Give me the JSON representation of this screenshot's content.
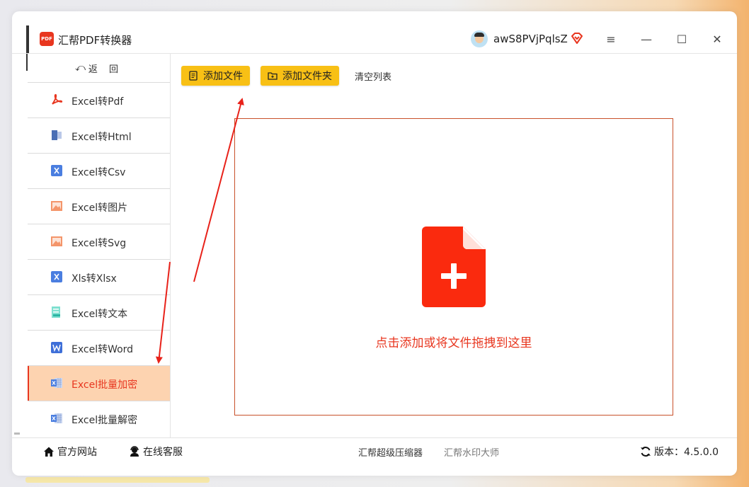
{
  "app": {
    "title": "汇帮PDF转换器",
    "logo_text": "PDF"
  },
  "user": {
    "name": "awS8PVjPqlsZ"
  },
  "window_controls": {
    "menu": "≡",
    "minimize": "—",
    "maximize": "☐",
    "close": "✕"
  },
  "sidebar": {
    "back": {
      "arrow": "⤺",
      "label": "返 回"
    },
    "items": [
      {
        "label": "Excel转Pdf",
        "icon": "pdf-icon"
      },
      {
        "label": "Excel转Html",
        "icon": "html-icon"
      },
      {
        "label": "Excel转Csv",
        "icon": "excel-x-icon"
      },
      {
        "label": "Excel转图片",
        "icon": "image-icon"
      },
      {
        "label": "Excel转Svg",
        "icon": "image-icon"
      },
      {
        "label": "Xls转Xlsx",
        "icon": "excel-x-icon"
      },
      {
        "label": "Excel转文本",
        "icon": "text-doc-icon"
      },
      {
        "label": "Excel转Word",
        "icon": "word-icon"
      },
      {
        "label": "Excel批量加密",
        "icon": "excel-sheet-icon",
        "active": true
      },
      {
        "label": "Excel批量解密",
        "icon": "excel-sheet-icon"
      }
    ]
  },
  "toolbar": {
    "add_file": "添加文件",
    "add_folder": "添加文件夹",
    "clear_list": "清空列表"
  },
  "dropzone": {
    "text": "点击添加或将文件拖拽到这里"
  },
  "footer": {
    "official_site": "官方网站",
    "online_service": "在线客服",
    "compressor": "汇帮超级压缩器",
    "watermark": "汇帮水印大师",
    "version_label": "版本：4.5.0.0"
  },
  "colors": {
    "accent_red": "#e8361f",
    "button_yellow": "#f8c015",
    "active_bg": "#fdd3b0",
    "dropzone_border": "#c8502a"
  }
}
